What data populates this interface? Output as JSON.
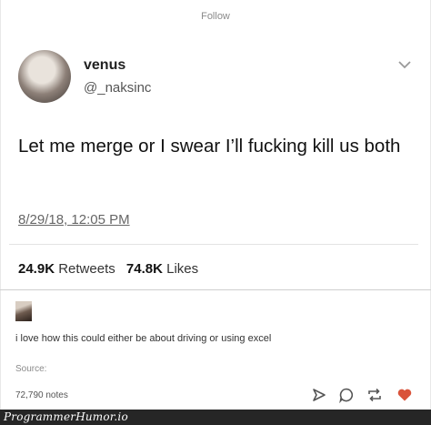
{
  "header": {
    "follow_label": "Follow"
  },
  "tweet": {
    "display_name": "venus",
    "handle": "@_naksinc",
    "text": "Let me merge or I swear I’ll fucking kill us both",
    "timestamp": "8/29/18, 12:05 PM",
    "retweets_count": "24.9K",
    "retweets_label": "Retweets",
    "likes_count": "74.8K",
    "likes_label": "Likes"
  },
  "post": {
    "comment": "i love how this could either be about driving or using excel",
    "source_label": "Source:",
    "notes": "72,790 notes",
    "action_icons": [
      "send-icon",
      "comment-icon",
      "reblog-icon",
      "heart-icon"
    ],
    "heart_color": "#d9533a"
  },
  "watermark": {
    "text": "ProgrammerHumor.io"
  }
}
